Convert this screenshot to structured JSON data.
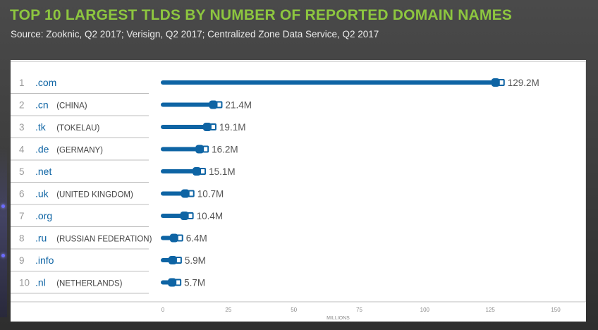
{
  "title": "TOP 10 LARGEST TLDS BY NUMBER OF REPORTED DOMAIN NAMES",
  "subtitle": "Source: Zooknic, Q2 2017; Verisign, Q2 2017; Centralized Zone Data Service, Q2 2017",
  "colors": {
    "title": "#8dc63f",
    "bar": "#0e64a4",
    "rank": "#9a9a9a",
    "tld": "#0e64a4",
    "country": "#444444",
    "value": "#555555",
    "separator": "#bdbdbd"
  },
  "chart_data": {
    "type": "bar",
    "orientation": "horizontal",
    "title": "TOP 10 LARGEST TLDS BY NUMBER OF REPORTED DOMAIN NAMES",
    "xlabel": "MILLIONS",
    "xlim": [
      0,
      150
    ],
    "xticks": [
      0,
      25,
      50,
      75,
      100,
      125,
      150
    ],
    "legend": "none",
    "grid": false,
    "categories": [
      {
        "rank": "1",
        "tld": ".com",
        "country": ""
      },
      {
        "rank": "2",
        "tld": ".cn",
        "country": "(CHINA)"
      },
      {
        "rank": "3",
        "tld": ".tk",
        "country": "(TOKELAU)"
      },
      {
        "rank": "4",
        "tld": ".de",
        "country": "(GERMANY)"
      },
      {
        "rank": "5",
        "tld": ".net",
        "country": ""
      },
      {
        "rank": "6",
        "tld": ".uk",
        "country": "(UNITED KINGDOM)"
      },
      {
        "rank": "7",
        "tld": ".org",
        "country": ""
      },
      {
        "rank": "8",
        "tld": ".ru",
        "country": "(RUSSIAN FEDERATION)"
      },
      {
        "rank": "9",
        "tld": ".info",
        "country": ""
      },
      {
        "rank": "10",
        "tld": ".nl",
        "country": "(NETHERLANDS)"
      }
    ],
    "values": [
      129.2,
      21.4,
      19.1,
      16.2,
      15.1,
      10.7,
      10.4,
      6.4,
      5.9,
      5.7
    ],
    "value_labels": [
      "129.2M",
      "21.4M",
      "19.1M",
      "16.2M",
      "15.1M",
      "10.7M",
      "10.4M",
      "6.4M",
      "5.9M",
      "5.7M"
    ]
  }
}
